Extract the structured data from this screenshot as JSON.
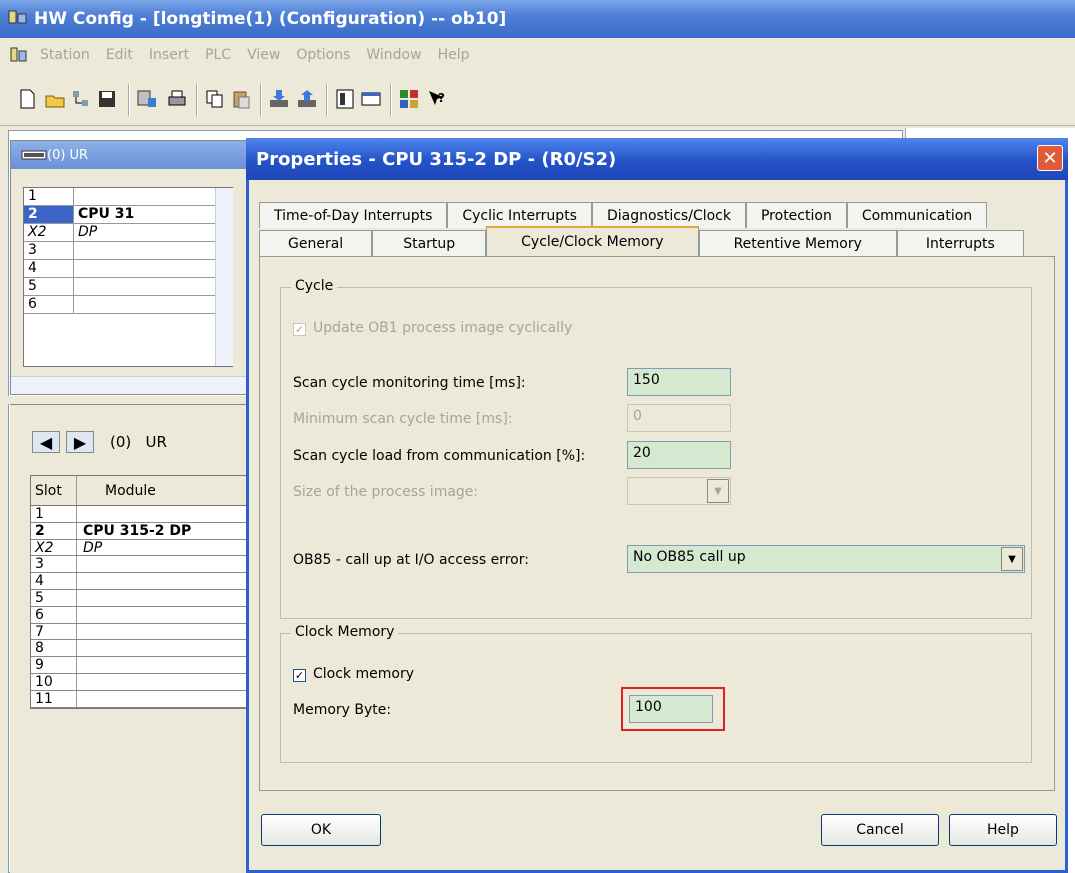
{
  "window": {
    "title": "HW Config - [longtime(1) (Configuration) -- ob10]"
  },
  "menu": [
    "Station",
    "Edit",
    "Insert",
    "PLC",
    "View",
    "Options",
    "Window",
    "Help"
  ],
  "toolbar_icons": [
    "new-icon",
    "open-icon",
    "network-icon",
    "save-icon",
    "compile-icon",
    "print-icon",
    "copy-icon",
    "paste-icon",
    "download-icon",
    "upload-icon",
    "catalog-icon",
    "window-icon",
    "netpro-icon",
    "help-icon"
  ],
  "rack": {
    "title": "(0) UR",
    "rows": [
      {
        "slot": "1",
        "module": ""
      },
      {
        "slot": "2",
        "module": "CPU 31"
      },
      {
        "slot": "X2",
        "module": "DP"
      },
      {
        "slot": "3",
        "module": ""
      },
      {
        "slot": "4",
        "module": ""
      },
      {
        "slot": "5",
        "module": ""
      },
      {
        "slot": "6",
        "module": ""
      }
    ]
  },
  "detail": {
    "nav_label": "(0)   UR",
    "col_slot": "Slot",
    "col_module": "Module",
    "rows": [
      {
        "slot": "1",
        "module": ""
      },
      {
        "slot": "2",
        "module": "CPU 315-2 DP"
      },
      {
        "slot": "X2",
        "module": "DP"
      },
      {
        "slot": "3",
        "module": ""
      },
      {
        "slot": "4",
        "module": ""
      },
      {
        "slot": "5",
        "module": ""
      },
      {
        "slot": "6",
        "module": ""
      },
      {
        "slot": "7",
        "module": ""
      },
      {
        "slot": "8",
        "module": ""
      },
      {
        "slot": "9",
        "module": ""
      },
      {
        "slot": "10",
        "module": ""
      },
      {
        "slot": "11",
        "module": ""
      }
    ]
  },
  "dialog": {
    "title": "Properties - CPU 315-2 DP - (R0/S2)",
    "tabs_row1": [
      "Time-of-Day Interrupts",
      "Cyclic Interrupts",
      "Diagnostics/Clock",
      "Protection",
      "Communication"
    ],
    "tabs_row2": [
      "General",
      "Startup",
      "Cycle/Clock Memory",
      "Retentive Memory",
      "Interrupts"
    ],
    "active_tab": "Cycle/Clock Memory",
    "cycle": {
      "group_label": "Cycle",
      "update_ob1_label": "Update OB1 process image cyclically",
      "scan_monitor_label": "Scan cycle monitoring time [ms]:",
      "scan_monitor_value": "150",
      "min_scan_label": "Minimum scan cycle time [ms]:",
      "min_scan_value": "0",
      "scan_load_label": "Scan cycle load from communication [%]:",
      "scan_load_value": "20",
      "process_image_label": "Size of the process image:",
      "ob85_label": "OB85 - call up at I/O access error:",
      "ob85_value": "No OB85 call up"
    },
    "clock": {
      "group_label": "Clock Memory",
      "clock_memory_label": "Clock memory",
      "memory_byte_label": "Memory Byte:",
      "memory_byte_value": "100"
    },
    "buttons": {
      "ok": "OK",
      "cancel": "Cancel",
      "help": "Help"
    }
  }
}
